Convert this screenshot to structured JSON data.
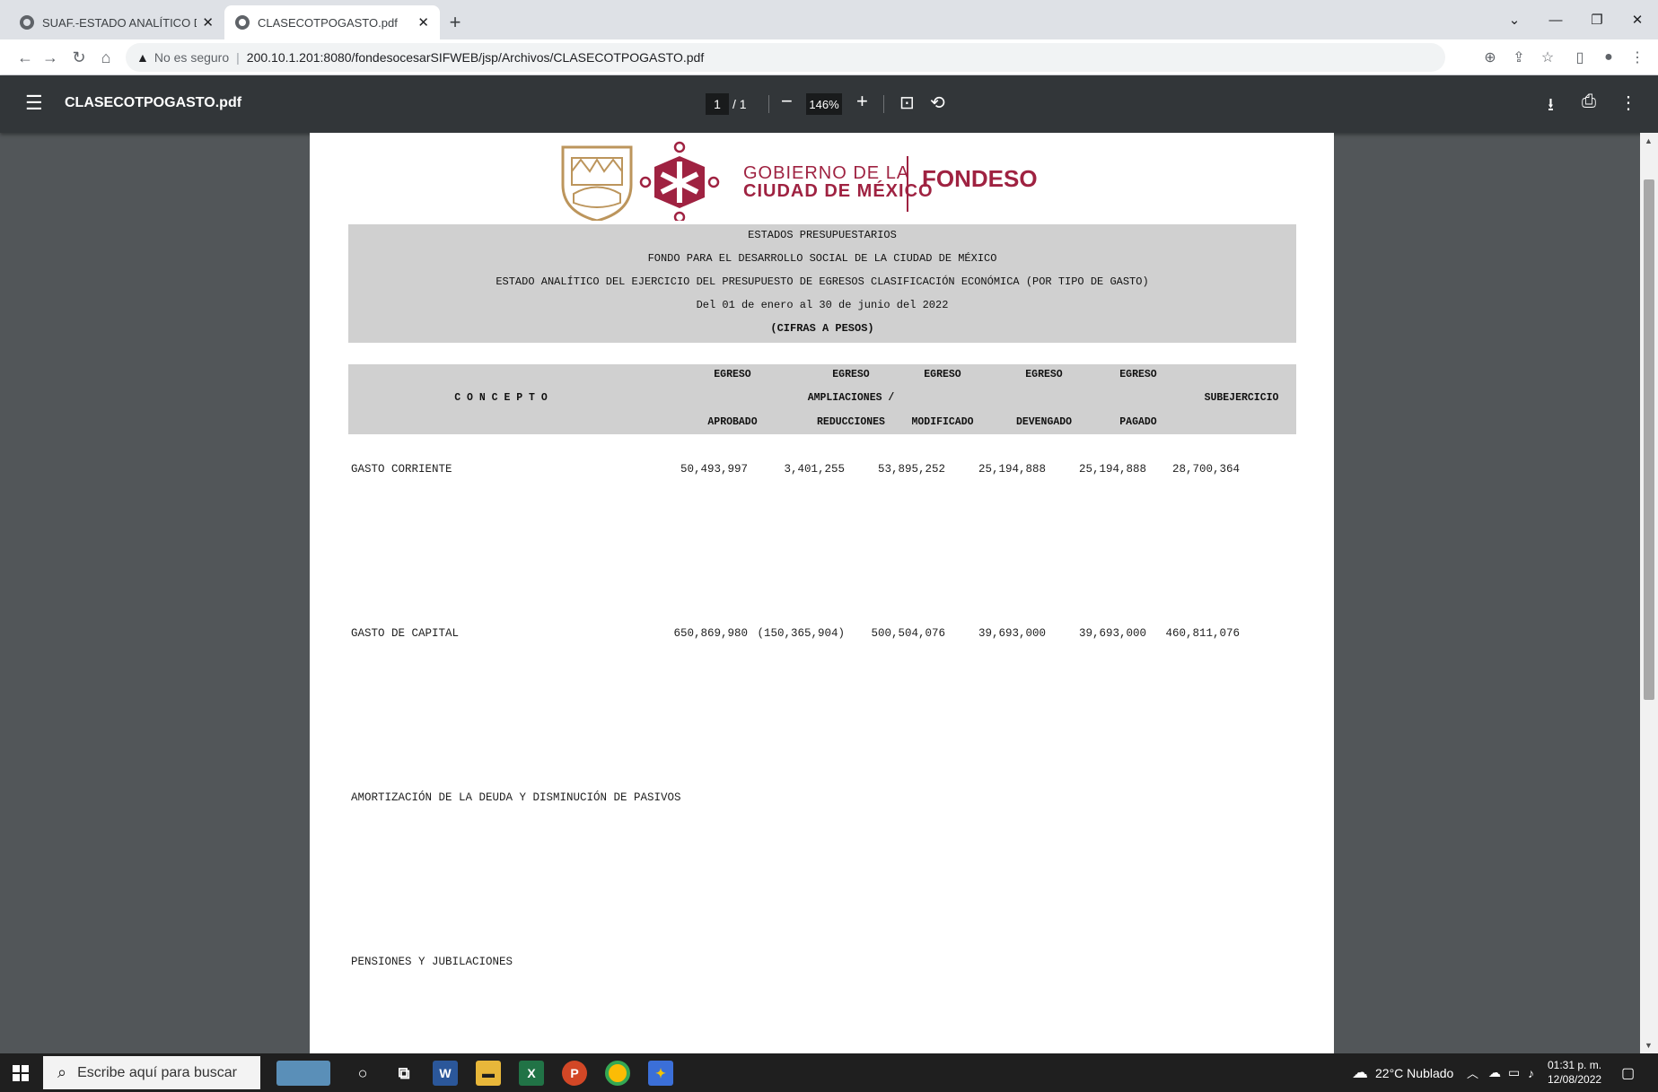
{
  "browser": {
    "tabs": [
      {
        "title": "SUAF.-ESTADO ANALÍTICO DEL EJ",
        "active": false
      },
      {
        "title": "CLASECOTPOGASTO.pdf",
        "active": true
      }
    ],
    "address": {
      "security_label": "No es seguro",
      "url": "200.10.1.201:8080/fondesocesarSIFWEB/jsp/Archivos/CLASECOTPOGASTO.pdf"
    }
  },
  "pdf_toolbar": {
    "filename": "CLASECOTPOGASTO.pdf",
    "current_page": "1",
    "total_pages": "/ 1",
    "zoom": "146%"
  },
  "document": {
    "logo": {
      "org_line1": "GOBIERNO DE LA",
      "org_line2": "CIUDAD DE MÉXICO",
      "brand": "FONDESO"
    },
    "header_lines": [
      "ESTADOS PRESUPUESTARIOS",
      "FONDO PARA EL DESARROLLO SOCIAL DE LA CIUDAD DE MÉXICO",
      "ESTADO ANALÍTICO DEL EJERCICIO DEL PRESUPUESTO DE EGRESOS CLASIFICACIÓN ECONÓMICA (POR TIPO DE GASTO)",
      "Del 01 de enero al 30 de junio del 2022",
      "(CIFRAS A PESOS)"
    ],
    "columns": {
      "concepto": "C O N C E P T O",
      "aprobado": [
        "EGRESO",
        "APROBADO"
      ],
      "ampliaciones": [
        "EGRESO",
        "AMPLIACIONES /",
        "REDUCCIONES"
      ],
      "modificado": [
        "EGRESO",
        "MODIFICADO"
      ],
      "devengado": [
        "EGRESO",
        "DEVENGADO"
      ],
      "pagado": [
        "EGRESO",
        "PAGADO"
      ],
      "subejercicio": "SUBEJERCICIO"
    },
    "rows": [
      {
        "concepto": "GASTO CORRIENTE",
        "aprobado": "50,493,997",
        "ampliaciones": "3,401,255",
        "modificado": "53,895,252",
        "devengado": "25,194,888",
        "pagado": "25,194,888",
        "subejercicio": "28,700,364"
      },
      {
        "concepto": "GASTO DE CAPITAL",
        "aprobado": "650,869,980",
        "ampliaciones": "(150,365,904)",
        "modificado": "500,504,076",
        "devengado": "39,693,000",
        "pagado": "39,693,000",
        "subejercicio": "460,811,076"
      },
      {
        "concepto": "AMORTIZACIÓN DE LA DEUDA Y DISMINUCIÓN DE PASIVOS",
        "aprobado": "",
        "ampliaciones": "",
        "modificado": "",
        "devengado": "",
        "pagado": "",
        "subejercicio": ""
      },
      {
        "concepto": "PENSIONES Y JUBILACIONES",
        "aprobado": "",
        "ampliaciones": "",
        "modificado": "",
        "devengado": "",
        "pagado": "",
        "subejercicio": ""
      }
    ]
  },
  "taskbar": {
    "search_placeholder": "Escribe aquí para buscar",
    "weather": "22°C Nublado",
    "time": "01:31 p. m.",
    "date": "12/08/2022"
  },
  "colors": {
    "pdf_toolbar": "#323639",
    "viewer_bg": "#525659",
    "header_gray": "#d0d0d0",
    "brand_red": "#9f2241",
    "gold": "#bc955c"
  }
}
